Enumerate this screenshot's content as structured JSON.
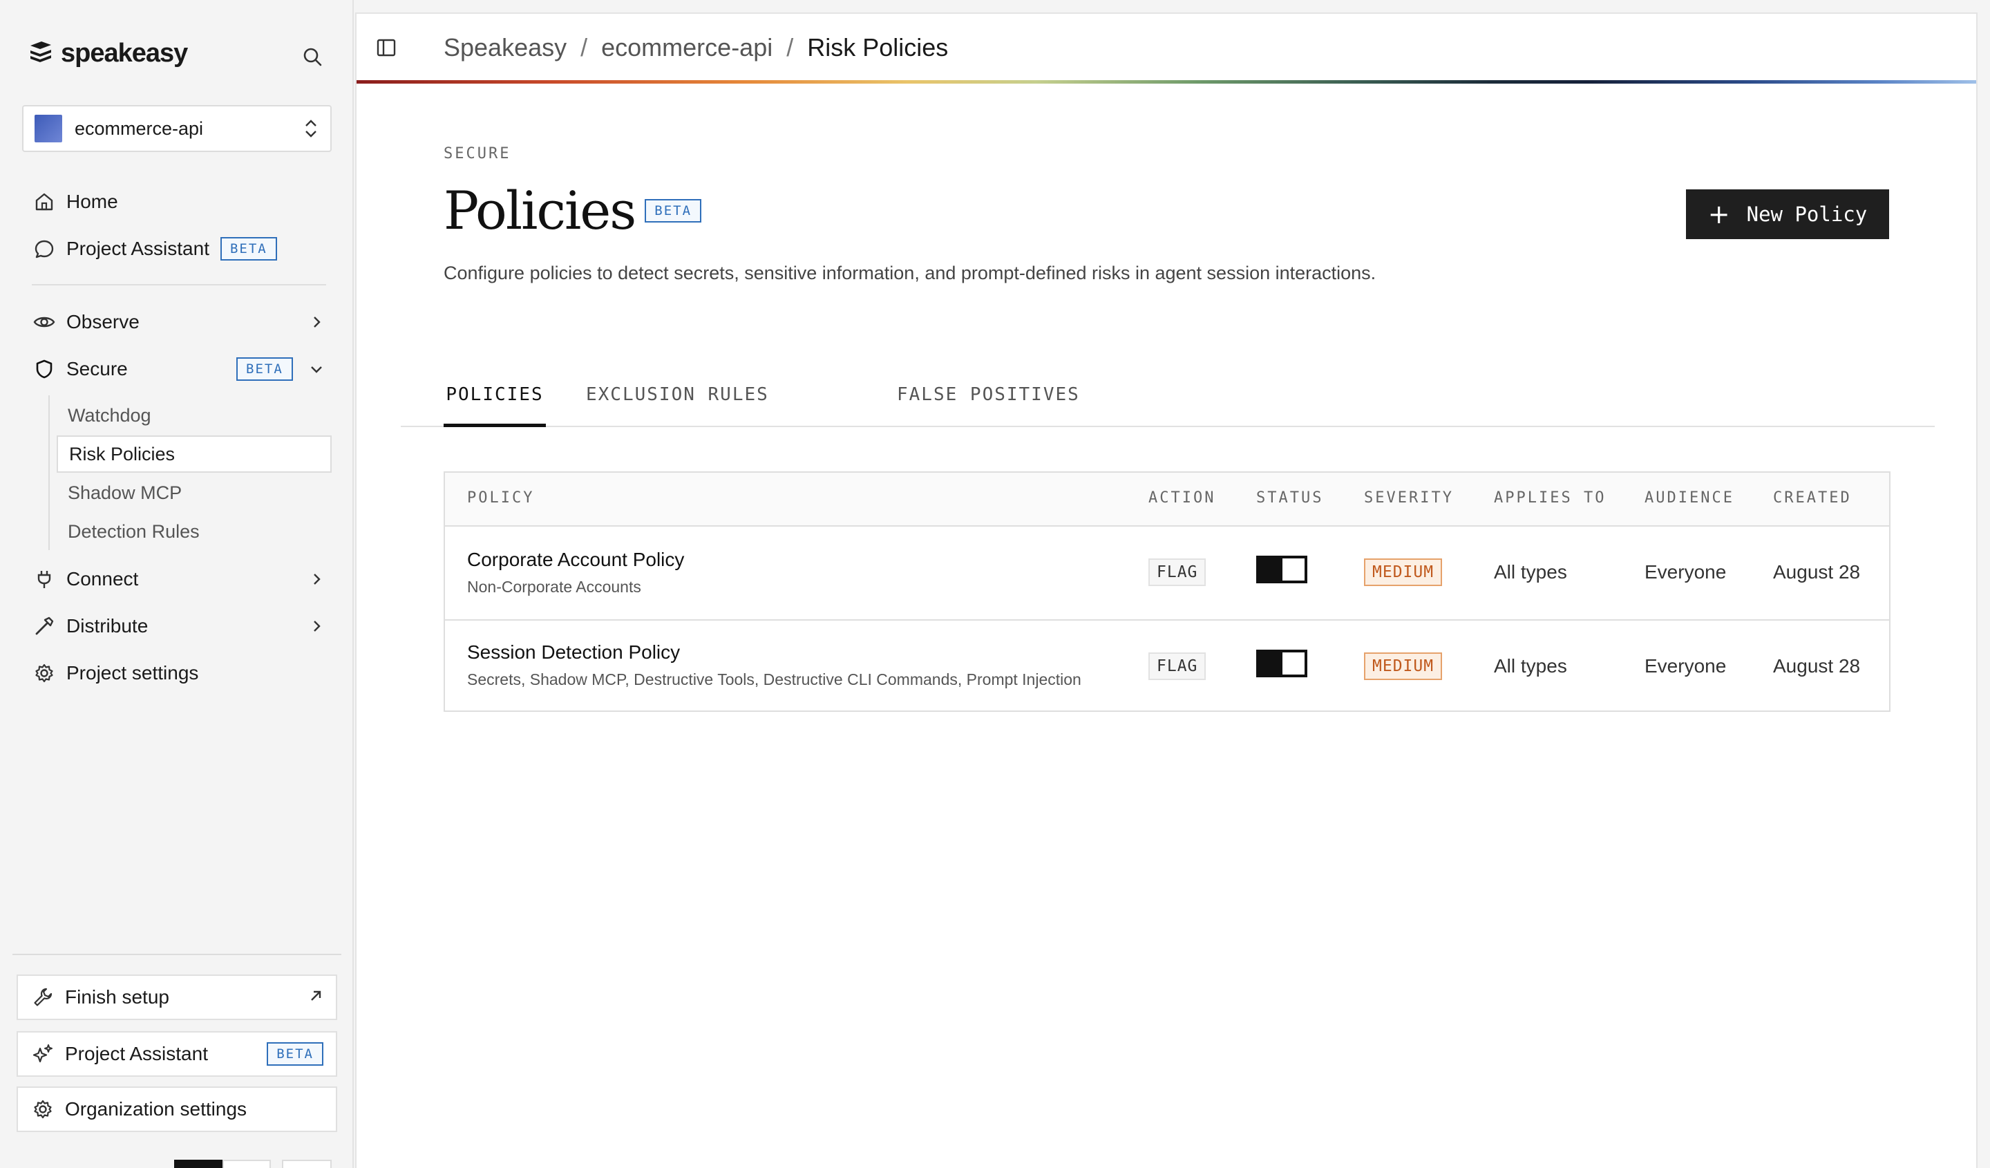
{
  "app": {
    "logo_text": "speakeasy",
    "project": "ecommerce-api"
  },
  "sidebar": {
    "primary": [
      {
        "label": "Home"
      },
      {
        "label": "Project Assistant",
        "badge": "BETA"
      }
    ],
    "sections": {
      "observe": "Observe",
      "secure": "Secure",
      "secure_badge": "BETA",
      "secure_items": [
        "Watchdog",
        "Risk Policies",
        "Shadow MCP",
        "Detection Rules"
      ],
      "connect": "Connect",
      "distribute": "Distribute",
      "project_settings": "Project settings"
    },
    "bottom": {
      "finish_setup": "Finish setup",
      "assistant": "Project Assistant",
      "assistant_badge": "BETA",
      "org_settings": "Organization settings"
    }
  },
  "breadcrumb": [
    "Speakeasy",
    "ecommerce-api",
    "Risk Policies"
  ],
  "header": {
    "eyebrow": "SECURE",
    "title": "Policies",
    "title_badge": "BETA",
    "description": "Configure policies to detect secrets, sensitive information, and prompt-defined risks in agent session interactions.",
    "new_policy_label": "New Policy"
  },
  "tabs": [
    {
      "label": "POLICIES",
      "active": true
    },
    {
      "label": "EXCLUSION RULES",
      "active": false
    },
    {
      "label": "FALSE POSITIVES",
      "active": false
    }
  ],
  "table": {
    "columns": [
      "POLICY",
      "ACTION",
      "STATUS",
      "SEVERITY",
      "APPLIES TO",
      "AUDIENCE",
      "CREATED"
    ],
    "rows": [
      {
        "name": "Corporate Account Policy",
        "detail": "Non-Corporate Accounts",
        "action": "FLAG",
        "status_on": true,
        "severity": "MEDIUM",
        "applies_to": "All types",
        "audience": "Everyone",
        "created": "August 28"
      },
      {
        "name": "Session Detection Policy",
        "detail": "Secrets, Shadow MCP, Destructive Tools, Destructive CLI Commands, Prompt Injection",
        "action": "FLAG",
        "status_on": true,
        "severity": "MEDIUM",
        "applies_to": "All types",
        "audience": "Everyone",
        "created": "August 28"
      }
    ]
  },
  "colors": {
    "accent_beta": "#2f6fba",
    "severity_medium": "#c0591d",
    "button_dark": "#1f1f1f"
  }
}
